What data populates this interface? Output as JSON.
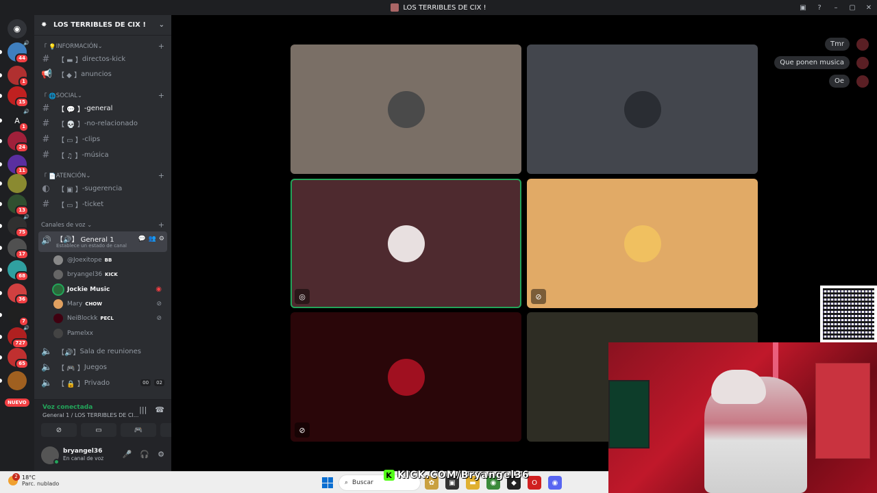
{
  "window": {
    "title": "LOS TERRIBLES DE CIX !"
  },
  "servers": [
    {
      "badge": "44",
      "color": "#3f7fbf",
      "vol": true
    },
    {
      "badge": "1",
      "color": "#b03030"
    },
    {
      "badge": "15",
      "color": "#c02020"
    },
    {
      "badge": "1",
      "letter": "A",
      "color": "#1e1f22",
      "vol": true
    },
    {
      "badge": "24",
      "color": "#a0203a"
    },
    {
      "badge": "11",
      "color": "#5a2fa0"
    },
    {
      "badge": "",
      "color": "#8a8a30"
    },
    {
      "badge": "13",
      "color": "#305030"
    },
    {
      "badge": "75",
      "color": "#303030",
      "vol": true
    },
    {
      "badge": "17",
      "color": "#505050"
    },
    {
      "badge": "68",
      "color": "#30a0a0"
    },
    {
      "badge": "36",
      "color": "#d04040"
    },
    {
      "badge": "7",
      "color": "#202020"
    },
    {
      "badge": "727",
      "color": "#b02020",
      "vol": true
    },
    {
      "badge": "65",
      "color": "#c03030"
    },
    {
      "badge": "",
      "color": "#a06020"
    }
  ],
  "nuevo_label": "NUEVO",
  "guild": {
    "name": "LOS TERRIBLES DE CIX !"
  },
  "categories": {
    "info": "INFORMACIÓN",
    "social": "SOCIAL",
    "atencion": "ATENCIÓN",
    "voz": "Canales de voz"
  },
  "channels": {
    "directos": "directos-kick",
    "anuncios": "anuncios",
    "general": "-general",
    "norel": "-no-relacionado",
    "clips": "-clips",
    "musica": "-música",
    "sugerencia": "-sugerencia",
    "ticket": "-ticket"
  },
  "voice_channel": {
    "name": "General 1",
    "status": "Establece un estado de canal"
  },
  "voice_users": [
    {
      "name": "@Joexitope",
      "tag": "BB",
      "color": "#888"
    },
    {
      "name": "bryangel36",
      "tag": "KICK",
      "color": "#666"
    },
    {
      "name": "Jockie Music",
      "tag": "",
      "color": "#2a6a3a",
      "speaking": true
    },
    {
      "name": "Mary",
      "tag": "CHOW",
      "color": "#e0a060"
    },
    {
      "name": "NeiBlockk",
      "tag": "PECL",
      "color": "#400010"
    },
    {
      "name": "Pamelxx",
      "tag": "",
      "color": "#444"
    }
  ],
  "other_voice": {
    "reuniones": "Sala de reuniones",
    "juegos": "Juegos",
    "privado": "Privado",
    "privado_a": "00",
    "privado_b": "02"
  },
  "voice_panel": {
    "status": "Voz conectada",
    "location": "General 1 / LOS TERRIBLES DE CI..."
  },
  "user": {
    "name": "bryangel36",
    "status": "En canal de voz"
  },
  "tiles": [
    {
      "bg": "#7a6f66",
      "avatar": "#4a4a4a"
    },
    {
      "bg": "#43464d",
      "avatar": "#2a2d33"
    },
    {
      "bg": "#4e2a2f",
      "avatar": "#e8e0e0",
      "speaking": true,
      "mic": "stream"
    },
    {
      "bg": "#e1aa66",
      "avatar": "#f0c060",
      "mic": "muted"
    },
    {
      "bg": "#2a0609",
      "avatar": "#a01020",
      "mic": "muted"
    },
    {
      "bg": "#2e2d24",
      "avatar": ""
    }
  ],
  "chat": [
    "Tmr",
    "Que ponen musica",
    "Oe"
  ],
  "kick_overlay": "KICK.COM/Bryangel36",
  "taskbar": {
    "temp": "18°C",
    "condition": "Parc. nublado",
    "weather_badge": "2",
    "search": "Buscar"
  }
}
